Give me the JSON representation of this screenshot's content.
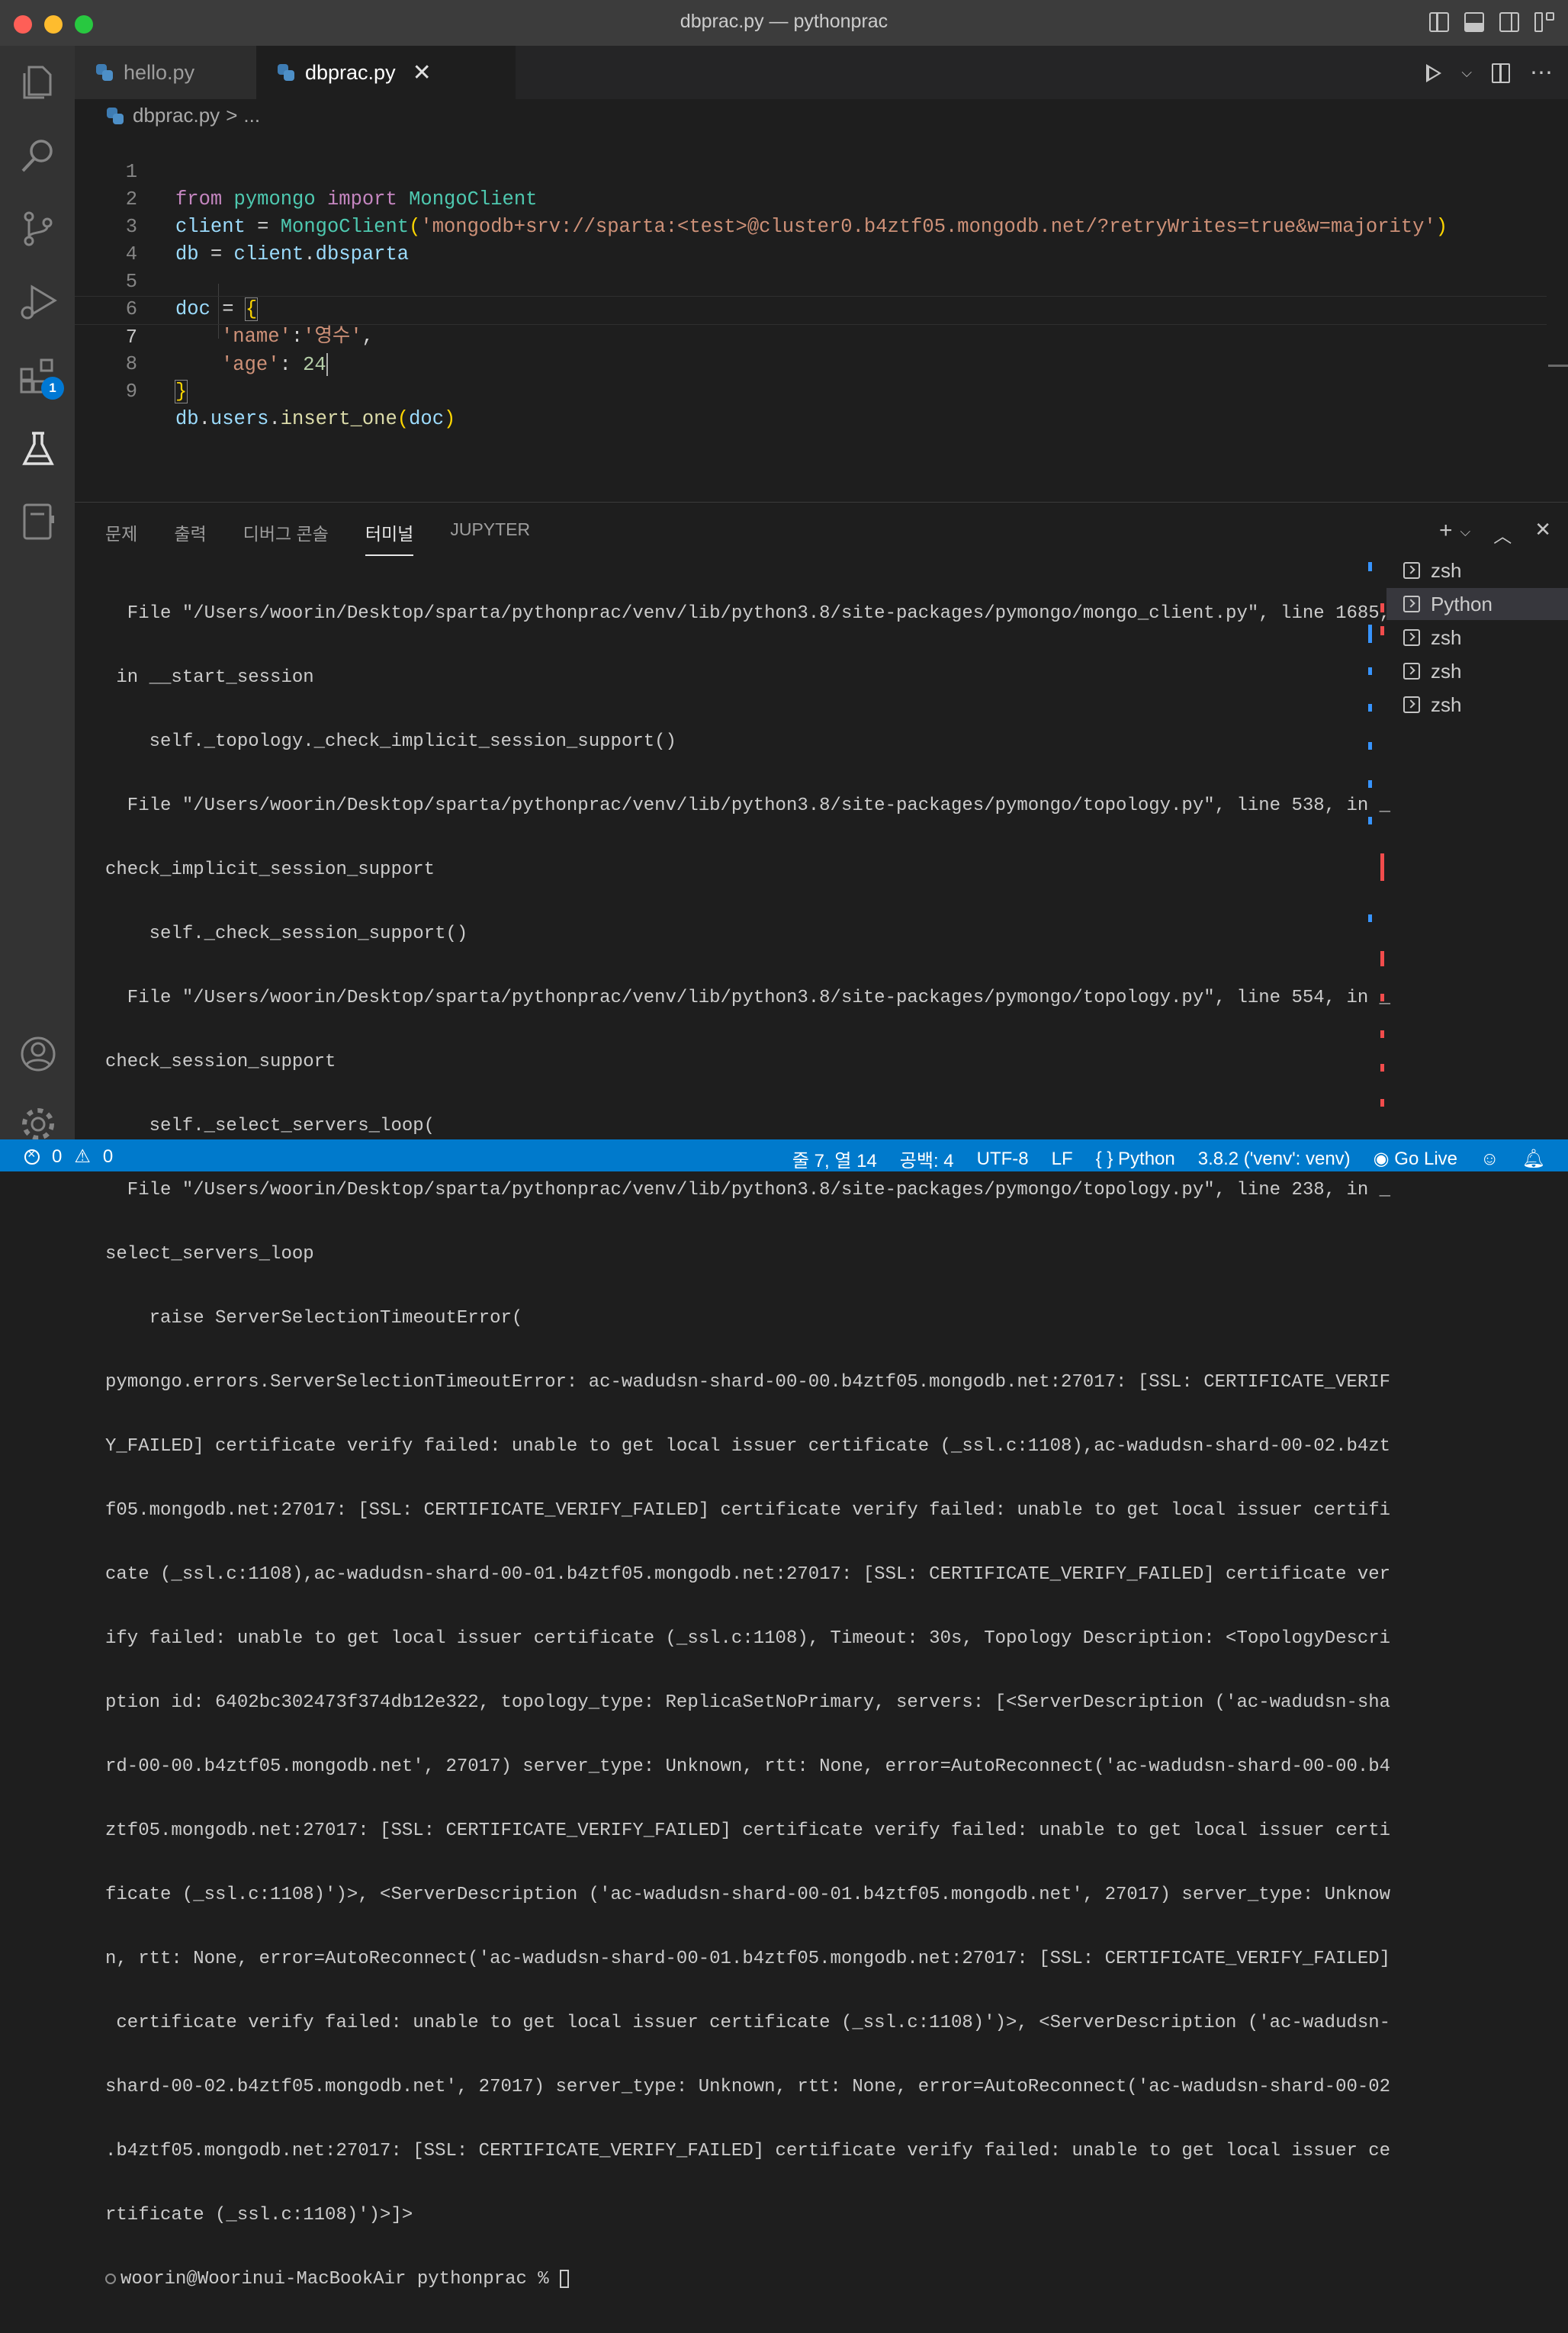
{
  "window": {
    "title": "dbprac.py — pythonprac"
  },
  "activity": {
    "extensions_badge": "1"
  },
  "tabs": [
    {
      "label": "hello.py"
    },
    {
      "label": "dbprac.py",
      "close": "✕"
    }
  ],
  "breadcrumb": {
    "file": "dbprac.py",
    "separator": ">",
    "rest": "..."
  },
  "editor": {
    "line_numbers": [
      "1",
      "2",
      "3",
      "4",
      "5",
      "6",
      "7",
      "8",
      "9"
    ],
    "line1": {
      "from": "from",
      "module": "pymongo",
      "import": "import",
      "cls": "MongoClient"
    },
    "line2": {
      "var": "client",
      "eq": " = ",
      "cls": "MongoClient",
      "open": "(",
      "str": "'mongodb+srv://sparta:<test>@cluster0.b4ztf05.mongodb.net/?retryWrites=true&w=majority'",
      "close": ")"
    },
    "line3": {
      "var": "db",
      "eq": " = ",
      "obj": "client",
      "dot": ".",
      "attr": "dbsparta"
    },
    "line5": {
      "var": "doc",
      "eq": " = ",
      "open": "{"
    },
    "line6": {
      "key": "'name'",
      "colon": ":",
      "val": "'영수'",
      "comma": ","
    },
    "line7": {
      "key": "'age'",
      "colon": ": ",
      "val": "24"
    },
    "line8": {
      "close": "}"
    },
    "line9": {
      "obj": "db",
      "dot1": ".",
      "attr": "users",
      "dot2": ".",
      "fn": "insert_one",
      "open": "(",
      "arg": "doc",
      "close": ")"
    }
  },
  "panel": {
    "tabs": [
      "문제",
      "출력",
      "디버그 콘솔",
      "터미널",
      "JUPYTER"
    ],
    "terminal_lines": [
      "  File \"/Users/woorin/Desktop/sparta/pythonprac/venv/lib/python3.8/site-packages/pymongo/mongo_client.py\", line 1685,",
      " in __start_session",
      "    self._topology._check_implicit_session_support()",
      "  File \"/Users/woorin/Desktop/sparta/pythonprac/venv/lib/python3.8/site-packages/pymongo/topology.py\", line 538, in _",
      "check_implicit_session_support",
      "    self._check_session_support()",
      "  File \"/Users/woorin/Desktop/sparta/pythonprac/venv/lib/python3.8/site-packages/pymongo/topology.py\", line 554, in _",
      "check_session_support",
      "    self._select_servers_loop(",
      "  File \"/Users/woorin/Desktop/sparta/pythonprac/venv/lib/python3.8/site-packages/pymongo/topology.py\", line 238, in _",
      "select_servers_loop",
      "    raise ServerSelectionTimeoutError(",
      "pymongo.errors.ServerSelectionTimeoutError: ac-wadudsn-shard-00-00.b4ztf05.mongodb.net:27017: [SSL: CERTIFICATE_VERIF",
      "Y_FAILED] certificate verify failed: unable to get local issuer certificate (_ssl.c:1108),ac-wadudsn-shard-00-02.b4zt",
      "f05.mongodb.net:27017: [SSL: CERTIFICATE_VERIFY_FAILED] certificate verify failed: unable to get local issuer certifi",
      "cate (_ssl.c:1108),ac-wadudsn-shard-00-01.b4ztf05.mongodb.net:27017: [SSL: CERTIFICATE_VERIFY_FAILED] certificate ver",
      "ify failed: unable to get local issuer certificate (_ssl.c:1108), Timeout: 30s, Topology Description: <TopologyDescri",
      "ption id: 6402bc302473f374db12e322, topology_type: ReplicaSetNoPrimary, servers: [<ServerDescription ('ac-wadudsn-sha",
      "rd-00-00.b4ztf05.mongodb.net', 27017) server_type: Unknown, rtt: None, error=AutoReconnect('ac-wadudsn-shard-00-00.b4",
      "ztf05.mongodb.net:27017: [SSL: CERTIFICATE_VERIFY_FAILED] certificate verify failed: unable to get local issuer certi",
      "ficate (_ssl.c:1108)')>, <ServerDescription ('ac-wadudsn-shard-00-01.b4ztf05.mongodb.net', 27017) server_type: Unknow",
      "n, rtt: None, error=AutoReconnect('ac-wadudsn-shard-00-01.b4ztf05.mongodb.net:27017: [SSL: CERTIFICATE_VERIFY_FAILED]",
      " certificate verify failed: unable to get local issuer certificate (_ssl.c:1108)')>, <ServerDescription ('ac-wadudsn-",
      "shard-00-02.b4ztf05.mongodb.net', 27017) server_type: Unknown, rtt: None, error=AutoReconnect('ac-wadudsn-shard-00-02",
      ".b4ztf05.mongodb.net:27017: [SSL: CERTIFICATE_VERIFY_FAILED] certificate verify failed: unable to get local issuer ce",
      "rtificate (_ssl.c:1108)')>]>"
    ],
    "prompt": "woorin@Woorinui-MacBookAir pythonprac % ",
    "terminals": [
      "zsh",
      "Python",
      "zsh",
      "zsh",
      "zsh"
    ]
  },
  "statusbar": {
    "errors": "0",
    "warnings": "0",
    "position": "줄 7, 열 14",
    "spaces": "공백: 4",
    "encoding": "UTF-8",
    "eol": "LF",
    "language": "Python",
    "interpreter": "3.8.2 ('venv': venv)",
    "golive": "Go Live"
  },
  "colors": {
    "accent": "#007acc",
    "titlebar": "#3c3c3c",
    "editor_bg": "#1e1e1e"
  }
}
